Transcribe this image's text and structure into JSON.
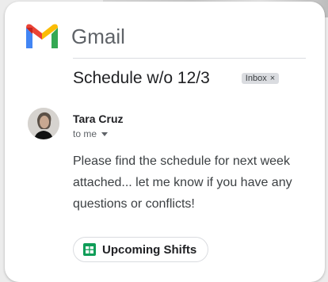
{
  "app": {
    "name": "Gmail",
    "logo_icon": "gmail-logo-icon"
  },
  "email": {
    "subject": "Schedule w/o 12/3",
    "label_badge": {
      "text": "Inbox",
      "close": "×"
    },
    "sender": "Tara Cruz",
    "recipient": "to me",
    "body": "Please find the schedule for next week attached... let me know if you have any questions or conflicts!"
  },
  "attachment": {
    "name": "Upcoming Shifts",
    "icon": "google-sheets-icon"
  },
  "colors": {
    "gmail_red": "#EA4335",
    "gmail_blue": "#4285F4",
    "gmail_green": "#34A853",
    "gmail_yellow": "#FBBC04",
    "sheets_green": "#0F9D58"
  }
}
